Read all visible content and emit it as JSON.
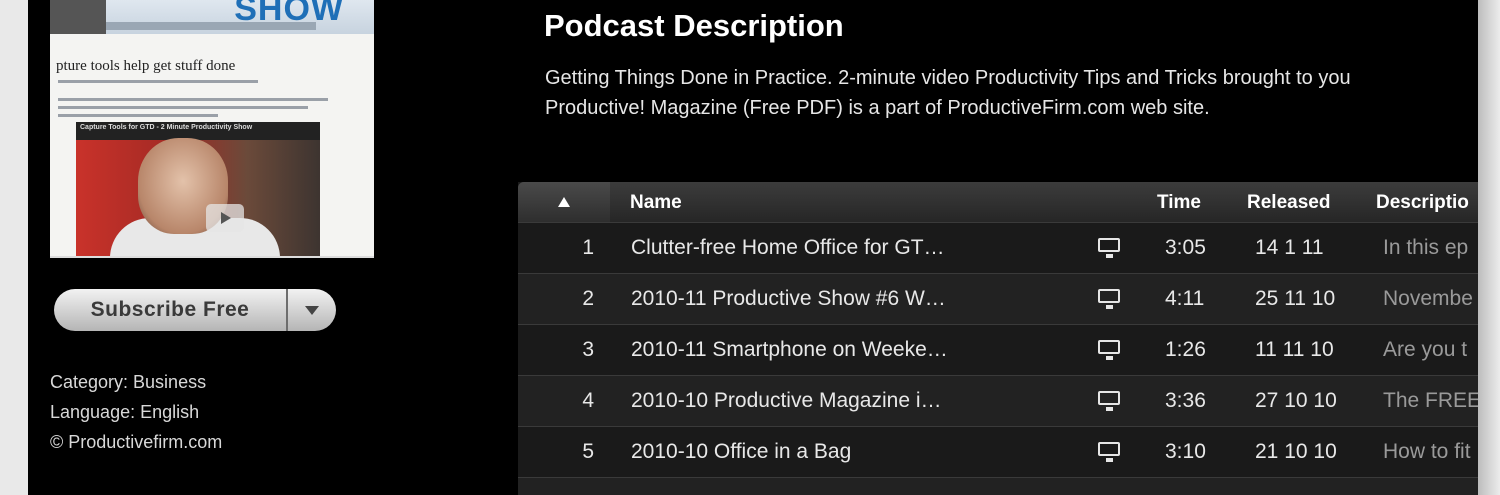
{
  "podcast": {
    "subscribe_label": "Subscribe Free",
    "category": "Category: Business",
    "language": "Language: English",
    "copyright": "© Productivefirm.com",
    "artwork": {
      "show_text": "SHOW",
      "heading": "pture tools help get stuff done",
      "video_title": "Capture Tools for GTD - 2 Minute Productivity Show"
    }
  },
  "description": {
    "title": "Podcast Description",
    "line1": "Getting Things Done in Practice. 2-minute video Productivity Tips and Tricks brought to you",
    "line2": "Productive! Magazine (Free PDF) is a part of ProductiveFirm.com web site."
  },
  "table": {
    "columns": {
      "name": "Name",
      "time": "Time",
      "released": "Released",
      "description": "Descriptio"
    },
    "sort_icon": "sort-ascending-icon",
    "media_icon": "video-tv-icon",
    "rows": [
      {
        "num": "1",
        "name": "Clutter-free Home Office for GT…",
        "time": "3:05",
        "released": "14 1 11",
        "description": "In this ep"
      },
      {
        "num": "2",
        "name": "2010-11 Productive Show #6 W…",
        "time": "4:11",
        "released": "25 11 10",
        "description": "Novembe"
      },
      {
        "num": "3",
        "name": "2010-11 Smartphone on Weeke…",
        "time": "1:26",
        "released": "11 11 10",
        "description": "Are you t"
      },
      {
        "num": "4",
        "name": "2010-10 Productive Magazine i…",
        "time": "3:36",
        "released": "27 10 10",
        "description": "The FREE"
      },
      {
        "num": "5",
        "name": "2010-10 Office in a Bag",
        "time": "3:10",
        "released": "21 10 10",
        "description": "How to fit"
      }
    ]
  }
}
